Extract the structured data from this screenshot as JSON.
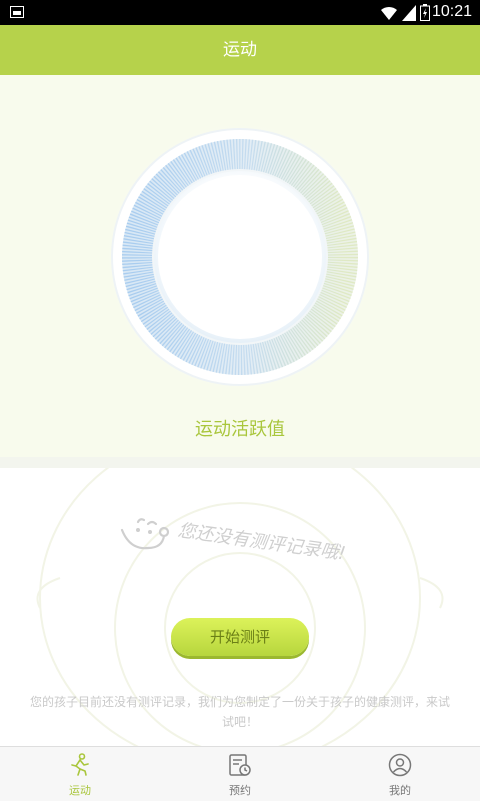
{
  "status_bar": {
    "time": "10:21"
  },
  "header": {
    "title": "运动"
  },
  "hero": {
    "label": "运动活跃值"
  },
  "empty_state": {
    "title": "您还没有测评记录哦!",
    "button_label": "开始测评",
    "description": "您的孩子目前还没有测评记录，我们为您制定了一份关于孩子的健康测评，来试试吧！"
  },
  "tabs": [
    {
      "label": "运动",
      "icon": "runner-icon",
      "active": true
    },
    {
      "label": "预约",
      "icon": "calendar-clock-icon",
      "active": false
    },
    {
      "label": "我的",
      "icon": "user-icon",
      "active": false
    }
  ],
  "colors": {
    "accent": "#b6d24b",
    "hero_bg": "#f8fbed",
    "ring_blue": "#a9cdef",
    "ring_green": "#d4e3a8"
  }
}
